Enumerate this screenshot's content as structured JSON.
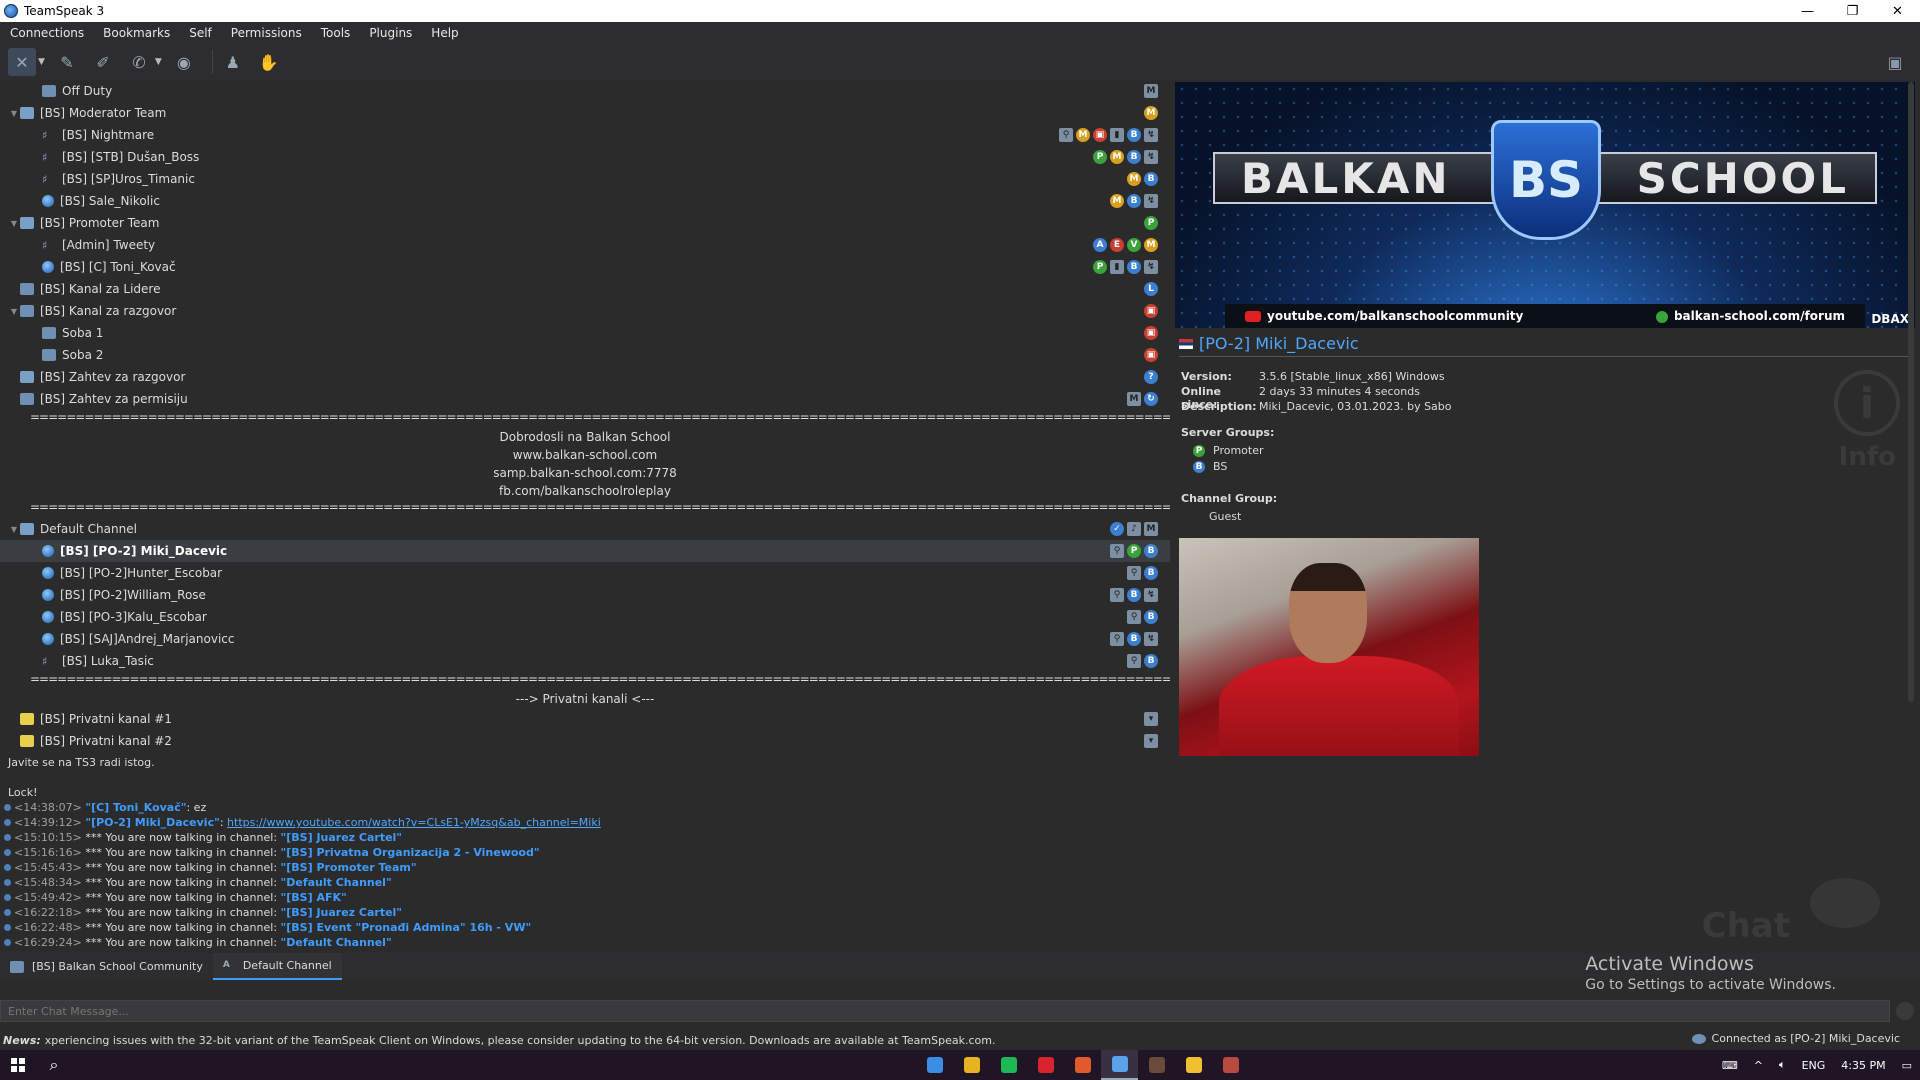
{
  "window": {
    "title": "TeamSpeak 3",
    "minimize": "—",
    "restore": "❐",
    "close": "✕"
  },
  "menu": [
    "Connections",
    "Bookmarks",
    "Self",
    "Permissions",
    "Tools",
    "Plugins",
    "Help"
  ],
  "tree": {
    "rows": [
      {
        "indent": 2,
        "type": "channel",
        "label": "Off Duty",
        "badges": [
          {
            "c": "sq",
            "t": "M"
          }
        ]
      },
      {
        "indent": 1,
        "type": "channel-open",
        "arrow": "v",
        "label": "[BS] Moderator Team",
        "badges": [
          {
            "c": "o",
            "t": "M"
          }
        ]
      },
      {
        "indent": 2,
        "type": "user-mute",
        "label": "[BS] Nightmare",
        "badges": [
          {
            "c": "sq",
            "t": "⚲"
          },
          {
            "c": "o",
            "t": "M"
          },
          {
            "c": "r",
            "t": "▣"
          },
          {
            "c": "sq",
            "t": "▮"
          },
          {
            "c": "b",
            "t": "B"
          },
          {
            "c": "sq",
            "t": "↯"
          }
        ]
      },
      {
        "indent": 2,
        "type": "user-mute",
        "label": "[BS] [STB] Dušan_Boss",
        "badges": [
          {
            "c": "g",
            "t": "P"
          },
          {
            "c": "o",
            "t": "M"
          },
          {
            "c": "b",
            "t": "B"
          },
          {
            "c": "sq",
            "t": "↯"
          }
        ]
      },
      {
        "indent": 2,
        "type": "user-mute",
        "label": "[BS] [SP]Uros_Timanic",
        "badges": [
          {
            "c": "o",
            "t": "M"
          },
          {
            "c": "b",
            "t": "B"
          }
        ]
      },
      {
        "indent": 2,
        "type": "user",
        "label": "[BS] Sale_Nikolic",
        "badges": [
          {
            "c": "o",
            "t": "M"
          },
          {
            "c": "b",
            "t": "B"
          },
          {
            "c": "sq",
            "t": "↯"
          }
        ]
      },
      {
        "indent": 1,
        "type": "channel-open",
        "arrow": "v",
        "label": "[BS] Promoter Team",
        "badges": [
          {
            "c": "g",
            "t": "P"
          }
        ]
      },
      {
        "indent": 2,
        "type": "user-mute",
        "label": "[Admin] Tweety",
        "badges": [
          {
            "c": "b",
            "t": "A"
          },
          {
            "c": "r",
            "t": "E"
          },
          {
            "c": "g",
            "t": "V"
          },
          {
            "c": "o",
            "t": "M"
          }
        ]
      },
      {
        "indent": 2,
        "type": "user",
        "label": "[BS] [C] Toni_Kovač",
        "badges": [
          {
            "c": "g",
            "t": "P"
          },
          {
            "c": "sq",
            "t": "▮"
          },
          {
            "c": "b",
            "t": "B"
          },
          {
            "c": "sq",
            "t": "↯"
          }
        ]
      },
      {
        "indent": 1,
        "type": "channel",
        "label": "[BS] Kanal za Lidere",
        "badges": [
          {
            "c": "b",
            "t": "L"
          }
        ]
      },
      {
        "indent": 1,
        "type": "channel",
        "arrow": "v",
        "label": "[BS] Kanal za razgovor",
        "badges": [
          {
            "c": "r",
            "t": "▣"
          }
        ]
      },
      {
        "indent": 2,
        "type": "channel",
        "label": "Soba 1",
        "badges": [
          {
            "c": "r",
            "t": "▣"
          }
        ]
      },
      {
        "indent": 2,
        "type": "channel",
        "label": "Soba 2",
        "badges": [
          {
            "c": "r",
            "t": "▣"
          }
        ]
      },
      {
        "indent": 1,
        "type": "channel-open",
        "label": "[BS] Zahtev za razgovor",
        "badges": [
          {
            "c": "b",
            "t": "?"
          }
        ]
      },
      {
        "indent": 1,
        "type": "channel",
        "label": "[BS] Zahtev za permisiju",
        "badges": [
          {
            "c": "sq",
            "t": "M"
          },
          {
            "c": "b",
            "t": "↻"
          }
        ]
      }
    ],
    "separator": "==================================================================================================================================================================================================================",
    "welcome_lines": [
      "Dobrodosli na Balkan School",
      "www.balkan-school.com",
      "samp.balkan-school.com:7778",
      "fb.com/balkanschoolroleplay"
    ],
    "default_channel": {
      "label": "Default Channel",
      "badges": [
        {
          "c": "b",
          "t": "✓"
        },
        {
          "c": "sq",
          "t": "♪"
        },
        {
          "c": "sq",
          "t": "M"
        }
      ]
    },
    "default_users": [
      {
        "label": "[BS] [PO-2] Miki_Dacevic",
        "selected": true,
        "badges": [
          {
            "c": "sq",
            "t": "⚲"
          },
          {
            "c": "g",
            "t": "P"
          },
          {
            "c": "b",
            "t": "B"
          }
        ]
      },
      {
        "label": "[BS] [PO-2]Hunter_Escobar",
        "badges": [
          {
            "c": "sq",
            "t": "⚲"
          },
          {
            "c": "b",
            "t": "B"
          }
        ]
      },
      {
        "label": "[BS] [PO-2]William_Rose",
        "badges": [
          {
            "c": "sq",
            "t": "⚲"
          },
          {
            "c": "b",
            "t": "B"
          },
          {
            "c": "sq",
            "t": "↯"
          }
        ]
      },
      {
        "label": "[BS] [PO-3]Kalu_Escobar",
        "badges": [
          {
            "c": "sq",
            "t": "⚲"
          },
          {
            "c": "b",
            "t": "B"
          }
        ]
      },
      {
        "label": "[BS] [SAJ]Andrej_Marjanovicc",
        "badges": [
          {
            "c": "sq",
            "t": "⚲"
          },
          {
            "c": "b",
            "t": "B"
          },
          {
            "c": "sq",
            "t": "↯"
          }
        ]
      },
      {
        "label": "[BS] Luka_Tasic",
        "mute": true,
        "badges": [
          {
            "c": "sq",
            "t": "⚲"
          },
          {
            "c": "b",
            "t": "B"
          }
        ]
      }
    ],
    "private_header": "---> Privatni kanali <---",
    "private_channels": [
      {
        "label": "[BS] Privatni kanal #1",
        "badges": [
          {
            "c": "sq",
            "t": "▾"
          }
        ]
      },
      {
        "label": "[BS] Privatni kanal #2",
        "badges": [
          {
            "c": "sq",
            "t": "▾"
          }
        ]
      }
    ]
  },
  "banner": {
    "left_word": "BALKAN",
    "right_word": "SCHOOL",
    "shield_text": "BS",
    "youtube": "youtube.com/balkanschoolcommunity",
    "forum": "balkan-school.com/forum",
    "corner": "DBAX"
  },
  "client": {
    "name": "[PO-2] Miki_Dacevic",
    "version_label": "Version:",
    "version": "3.5.6 [Stable_linux_x86] Windows",
    "online_label": "Online since:",
    "online": "2 days 33 minutes 4 seconds",
    "desc_label": "Description:",
    "description": "Miki_Dacevic, 03.01.2023. by Sabo",
    "server_groups_label": "Server Groups:",
    "server_groups": [
      "Promoter",
      "BS"
    ],
    "channel_group_label": "Channel Group:",
    "channel_group": "Guest",
    "watermark_info": "Info"
  },
  "chat": {
    "pre_lines": [
      "Javite se na TS3 radi istog.",
      "",
      "Lock!"
    ],
    "messages": [
      {
        "ts": "<14:38:07>",
        "name": "\"[C] Toni_Kovač\"",
        "text": ": ez"
      },
      {
        "ts": "<14:39:12>",
        "name": "\"[PO-2] Miki_Dacevic\"",
        "text": ": ",
        "link": "https://www.youtube.com/watch?v=CLsE1-yMzsq&ab_channel=Miki"
      },
      {
        "ts": "<15:10:15>",
        "prefix": " *** You are now talking in channel: ",
        "channel": "\"[BS] Juarez Cartel\""
      },
      {
        "ts": "<15:16:16>",
        "prefix": " *** You are now talking in channel: ",
        "channel": "\"[BS] Privatna Organizacija 2 - Vinewood\""
      },
      {
        "ts": "<15:45:43>",
        "prefix": " *** You are now talking in channel: ",
        "channel": "\"[BS] Promoter Team\""
      },
      {
        "ts": "<15:48:34>",
        "prefix": " *** You are now talking in channel: ",
        "channel": "\"Default Channel\""
      },
      {
        "ts": "<15:49:42>",
        "prefix": " *** You are now talking in channel: ",
        "channel": "\"[BS] AFK\""
      },
      {
        "ts": "<16:22:18>",
        "prefix": " *** You are now talking in channel: ",
        "channel": "\"[BS] Juarez Cartel\""
      },
      {
        "ts": "<16:22:48>",
        "prefix": " *** You are now talking in channel: ",
        "channel": "\"[BS] Event \"Pronađi Admina\" 16h - VW\""
      },
      {
        "ts": "<16:29:24>",
        "prefix": " *** You are now talking in channel: ",
        "channel": "\"Default Channel\""
      }
    ],
    "watermark": "Chat"
  },
  "tabs": [
    {
      "label": "[BS] Balkan School Community",
      "active": false
    },
    {
      "label": "Default Channel",
      "active": true
    }
  ],
  "activate": {
    "line1": "Activate Windows",
    "line2": "Go to Settings to activate Windows."
  },
  "chat_input": {
    "placeholder": "Enter Chat Message..."
  },
  "status": {
    "news_label": "News:",
    "news": "xperiencing issues with the 32-bit variant of the TeamSpeak Client on Windows, please consider updating to the 64-bit version. Downloads are available at TeamSpeak.com.",
    "connected": "Connected as [PO-2] Miki_Dacevic"
  },
  "taskbar": {
    "apps": [
      {
        "name": "monitor-app",
        "color": "#3a8ee6"
      },
      {
        "name": "chrome-app",
        "color": "#e8b320"
      },
      {
        "name": "spotify-app",
        "color": "#1db954"
      },
      {
        "name": "opera-app",
        "color": "#d8242e"
      },
      {
        "name": "mic-app",
        "color": "#e05a2a"
      },
      {
        "name": "teamspeak-app",
        "color": "#5aa2ee",
        "active": true
      },
      {
        "name": "samp-app",
        "color": "#6b4a3a"
      },
      {
        "name": "explorer-app",
        "color": "#f0c030"
      },
      {
        "name": "game-app",
        "color": "#b84a40"
      }
    ],
    "lang": "ENG",
    "time": "4:35 PM"
  }
}
